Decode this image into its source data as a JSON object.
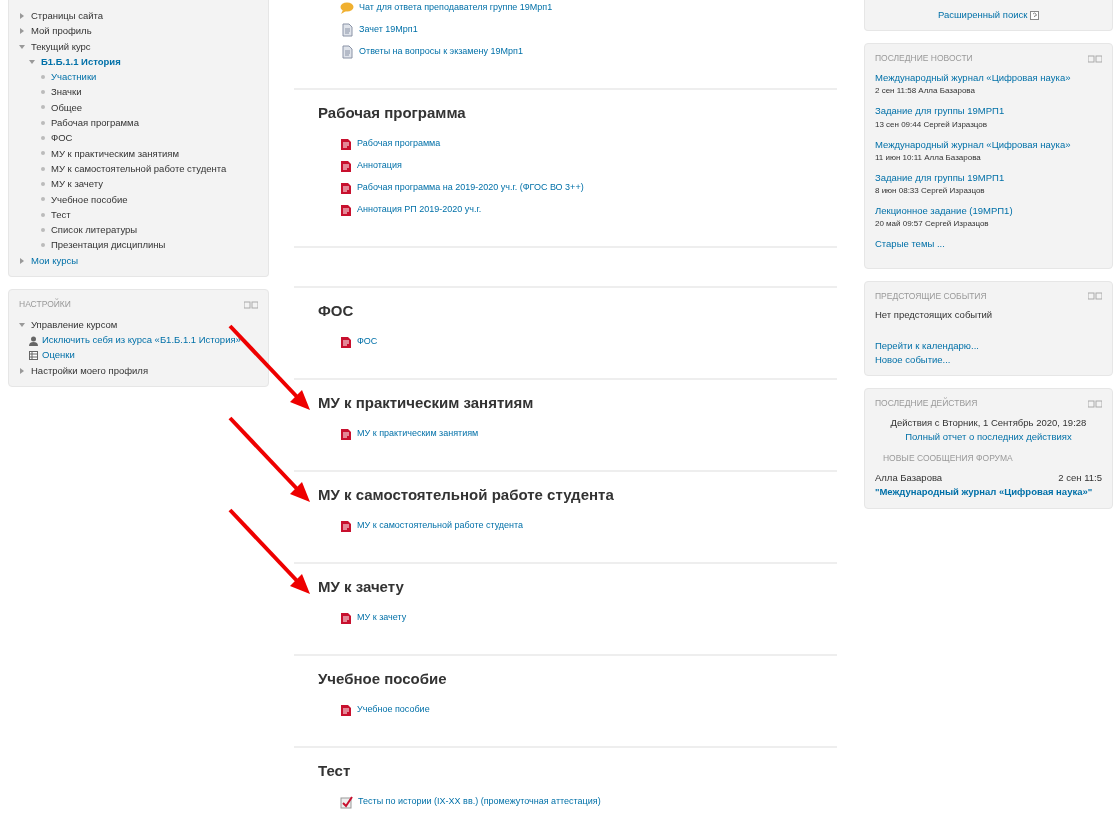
{
  "navigation": {
    "items": [
      {
        "label": "Страницы сайта",
        "expanded": false,
        "link": false
      },
      {
        "label": "Мой профиль",
        "expanded": false,
        "link": false
      },
      {
        "label": "Текущий курс",
        "expanded": true,
        "link": false,
        "children": [
          {
            "label": "Б1.Б.1.1 История",
            "expanded": true,
            "link": true,
            "children": [
              {
                "label": "Участники",
                "link": true
              },
              {
                "label": "Значки",
                "link": false
              },
              {
                "label": "Общее",
                "link": false
              },
              {
                "label": "Рабочая программа",
                "link": false
              },
              {
                "label": "ФОС",
                "link": false
              },
              {
                "label": "МУ к практическим занятиям",
                "link": false
              },
              {
                "label": "МУ к самостоятельной работе студента",
                "link": false
              },
              {
                "label": "МУ к зачету",
                "link": false
              },
              {
                "label": "Учебное пособие",
                "link": false
              },
              {
                "label": "Тест",
                "link": false
              },
              {
                "label": "Список литературы",
                "link": false
              },
              {
                "label": "Презентация дисциплины",
                "link": false
              }
            ]
          }
        ]
      },
      {
        "label": "Мои курсы",
        "expanded": false,
        "link": true
      }
    ]
  },
  "settings": {
    "title": "НАСТРОЙКИ",
    "items": [
      {
        "label": "Управление курсом",
        "expanded": true,
        "children": [
          {
            "kind": "user",
            "label": "Исключить себя из курса «Б1.Б.1.1 История»"
          },
          {
            "kind": "grades",
            "label": "Оценки"
          }
        ]
      },
      {
        "label": "Настройки моего профиля",
        "expanded": false
      }
    ]
  },
  "sections": [
    {
      "marked": false,
      "activities": [
        {
          "kind": "forum",
          "label": "Чат для ответа преподавателя группе 19Мрп1"
        },
        {
          "kind": "assign",
          "label": "Зачет 19Мрп1"
        },
        {
          "kind": "assign",
          "label": "Ответы на вопросы к экзамену 19Мрп1"
        }
      ]
    },
    {
      "title": "Рабочая программа",
      "marked": false,
      "activities": [
        {
          "kind": "pdf",
          "label": "Рабочая программа"
        },
        {
          "kind": "pdf",
          "label": "Аннотация"
        },
        {
          "kind": "pdf",
          "label": "Рабочая программа на 2019-2020 уч.г. (ФГОС ВО 3++)"
        },
        {
          "kind": "pdf",
          "label": "Аннотация РП 2019-2020 уч.г."
        }
      ]
    },
    {
      "marked": false
    },
    {
      "title": "ФОС",
      "marked": false,
      "activities": [
        {
          "kind": "pdf",
          "label": "ФОС"
        }
      ]
    },
    {
      "title": "МУ к практическим занятиям",
      "marked": true,
      "activities": [
        {
          "kind": "pdf",
          "label": "МУ к практическим занятиям"
        }
      ]
    },
    {
      "title": "МУ к самостоятельной работе студента",
      "marked": true,
      "activities": [
        {
          "kind": "pdf",
          "label": "МУ к самостоятельной работе студента"
        }
      ]
    },
    {
      "title": "МУ к зачету",
      "marked": true,
      "activities": [
        {
          "kind": "pdf",
          "label": "МУ к зачету"
        }
      ]
    },
    {
      "title": "Учебное пособие",
      "marked": false,
      "activities": [
        {
          "kind": "pdf",
          "label": "Учебное пособие"
        }
      ]
    },
    {
      "title": "Тест",
      "marked": false,
      "activities": [
        {
          "kind": "quiz",
          "label": "Тесты по истории (IX-XX вв.) (промежуточная аттестация)"
        }
      ]
    }
  ],
  "search_block": {
    "link": "Расширенный поиск"
  },
  "news": {
    "title": "ПОСЛЕДНИЕ НОВОСТИ",
    "items": [
      {
        "title": "Международный журнал «Цифровая наука»",
        "meta": "2 сен 11:58 Алла Базарова"
      },
      {
        "title": "Задание для группы 19МРП1",
        "meta": "13 сен 09:44 Сергей Изразцов"
      },
      {
        "title": "Международный журнал «Цифровая наука»",
        "meta": "11 июн 10:11 Алла Базарова"
      },
      {
        "title": "Задание для группы 19МРП1",
        "meta": "8 июн 08:33 Сергей Изразцов"
      },
      {
        "title": "Лекционное задание (19МРП1)",
        "meta": "20 май 09:57 Сергей Изразцов"
      }
    ],
    "more": "Старые темы ..."
  },
  "events": {
    "title": "ПРЕДСТОЯЩИЕ СОБЫТИЯ",
    "empty": "Нет предстоящих событий",
    "links": [
      "Перейти к календарю...",
      "Новое событие..."
    ]
  },
  "activity": {
    "title": "ПОСЛЕДНИЕ ДЕЙСТВИЯ",
    "since": "Действия с Вторник, 1 Сентябрь 2020, 19:28",
    "report": "Полный отчет о последних действиях",
    "subtitle": "НОВЫЕ СООБЩЕНИЯ ФОРУМА",
    "posts": [
      {
        "author": "Алла Базарова",
        "time": "2 сен 11:5",
        "title": "\"Международный журнал «Цифровая наука»\""
      }
    ]
  }
}
